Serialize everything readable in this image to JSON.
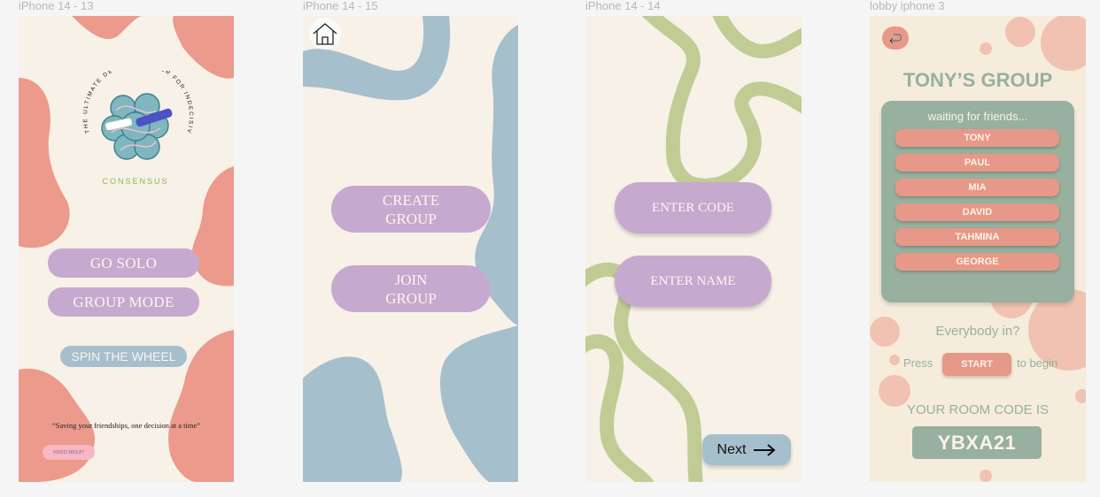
{
  "frames": {
    "f1": {
      "label": "iPhone 14 - 13"
    },
    "f2": {
      "label": "iPhone 14 - 15"
    },
    "f3": {
      "label": "iPhone 14 - 14"
    },
    "f4": {
      "label": "lobby iphone 3"
    }
  },
  "colors": {
    "coral": "#ec9a8b",
    "blue": "#a6bfcc",
    "green": "#c0cc94",
    "purple": "#c6a9cf",
    "sage": "#97b09f",
    "cream": "#f7f1e8"
  },
  "screen1": {
    "logo_arc_text": "THE ULTIMATE DECISION-MAKER FOR INDECISIVE FOLK",
    "logo_brand": "CONSENSUS",
    "go_solo": "GO SOLO",
    "group_mode": "GROUP MODE",
    "spin_wheel": "SPIN THE WHEEL",
    "tagline": "“Saving your friendships, one decision at a time”",
    "need_help": "NEED HELP?"
  },
  "screen2": {
    "home_icon": "home-icon",
    "create_group_line1": "CREATE",
    "create_group_line2": "GROUP",
    "join_group_line1": "JOIN",
    "join_group_line2": "GROUP"
  },
  "screen3": {
    "enter_code": "ENTER CODE",
    "enter_name": "ENTER NAME",
    "next": "Next",
    "next_icon": "arrow-right-icon"
  },
  "screen4": {
    "back_icon": "return-arrow-icon",
    "title": "TONY’S GROUP",
    "waiting": "waiting for friends...",
    "friends": [
      "TONY",
      "PAUL",
      "MIA",
      "DAVID",
      "TAHMINA",
      "GEORGE"
    ],
    "everybody_in": "Everybody in?",
    "press": "Press",
    "start": "START",
    "to_begin": "to begin",
    "room_code_label": "YOUR ROOM CODE IS",
    "room_code": "YBXA21"
  }
}
